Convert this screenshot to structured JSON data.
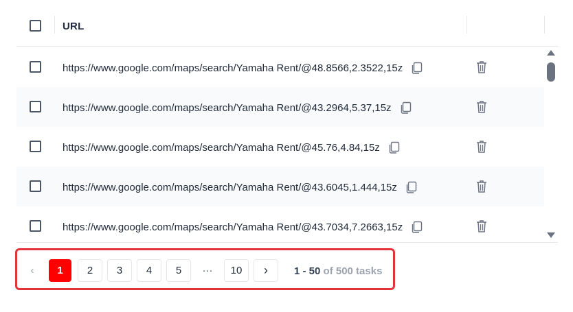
{
  "table": {
    "header": {
      "url_label": "URL"
    },
    "rows": [
      {
        "url": "https://www.google.com/maps/search/Yamaha Rent/@48.8566,2.3522,15z"
      },
      {
        "url": "https://www.google.com/maps/search/Yamaha Rent/@43.2964,5.37,15z"
      },
      {
        "url": "https://www.google.com/maps/search/Yamaha Rent/@45.76,4.84,15z"
      },
      {
        "url": "https://www.google.com/maps/search/Yamaha Rent/@43.6045,1.444,15z"
      },
      {
        "url": "https://www.google.com/maps/search/Yamaha Rent/@43.7034,7.2663,15z"
      }
    ]
  },
  "pagination": {
    "prev_label": "‹",
    "pages": [
      "1",
      "2",
      "3",
      "4",
      "5"
    ],
    "ellipsis": "···",
    "last_page": "10",
    "next_label": "›",
    "active_page": "1",
    "range": "1 - 50",
    "total": "of 500 tasks"
  },
  "colors": {
    "accent": "#ff0000",
    "highlight_border": "#e5333a"
  },
  "icons": [
    "checkbox",
    "copy-icon",
    "trash-icon",
    "chevron-left-icon",
    "chevron-right-icon",
    "scroll-up-icon",
    "scroll-down-icon"
  ]
}
